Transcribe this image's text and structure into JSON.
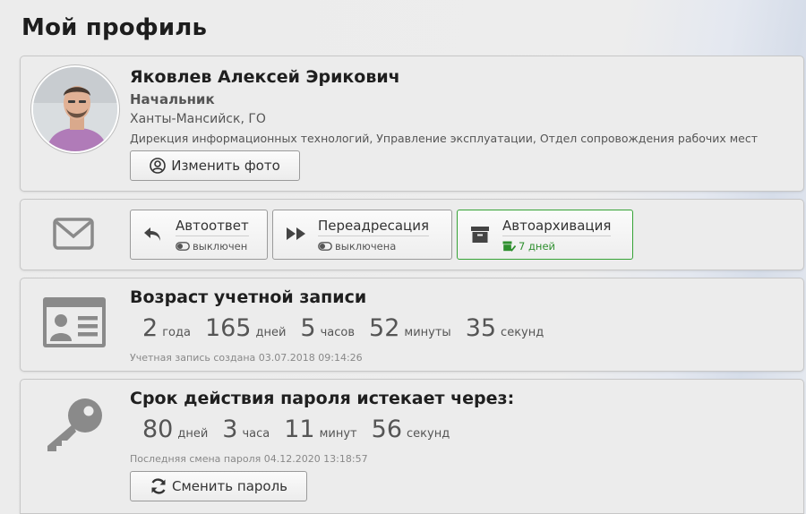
{
  "page": {
    "title": "Мой профиль"
  },
  "profile": {
    "name": "Яковлев Алексей Эрикович",
    "role": "Начальник",
    "city": "Ханты-Мансийск, ГО",
    "department": "Дирекция информационных технологий, Управление эксплуатации, Отдел сопровождения рабочих мест",
    "change_photo_label": "Изменить фото"
  },
  "mail": {
    "autoreply": {
      "title": "Автоответ",
      "status": "выключен"
    },
    "redirect": {
      "title": "Переадресация",
      "status": "выключена"
    },
    "archive": {
      "title": "Автоархивация",
      "status": "7 дней"
    }
  },
  "account_age": {
    "title": "Возраст учетной записи",
    "years": "2",
    "years_unit": "года",
    "days": "165",
    "days_unit": "дней",
    "hours": "5",
    "hours_unit": "часов",
    "minutes": "52",
    "minutes_unit": "минуты",
    "seconds": "35",
    "seconds_unit": "секунд",
    "created_note": "Учетная запись создана 03.07.2018 09:14:26"
  },
  "password": {
    "title": "Срок действия пароля истекает через:",
    "days": "80",
    "days_unit": "дней",
    "hours": "3",
    "hours_unit": "часа",
    "minutes": "11",
    "minutes_unit": "минут",
    "seconds": "56",
    "seconds_unit": "секунд",
    "changed_note": "Последняя смена пароля 04.12.2020 13:18:57",
    "change_label": "Сменить пароль"
  },
  "colors": {
    "accent_green": "#36a336",
    "icon_gray": "#8a8a8a"
  }
}
